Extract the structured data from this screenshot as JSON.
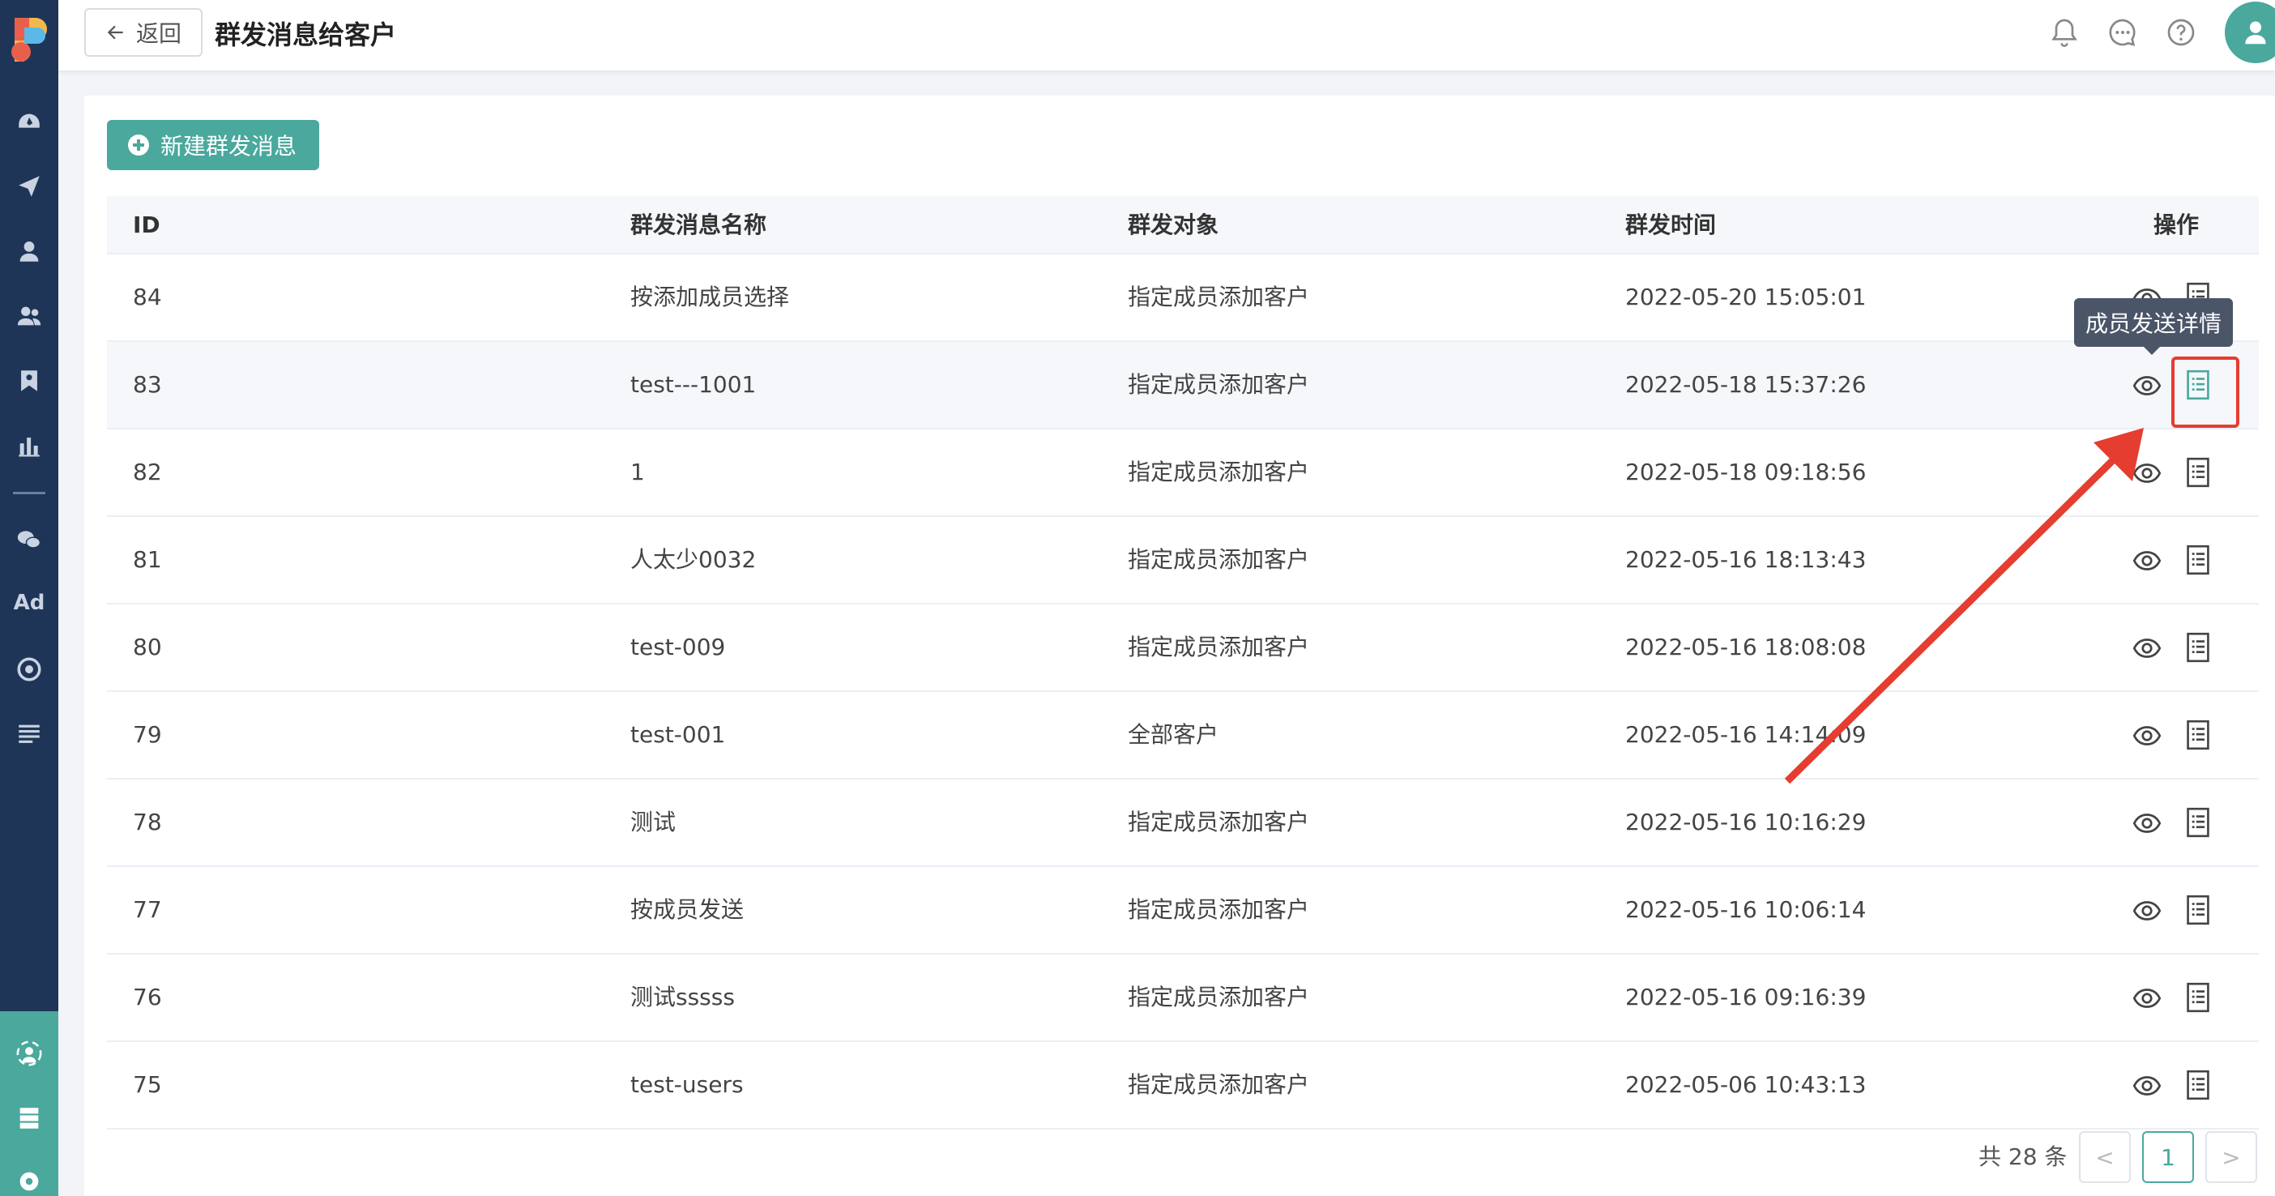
{
  "header": {
    "back_label": "返回",
    "title": "群发消息给客户"
  },
  "toolbar": {
    "new_label": "新建群发消息"
  },
  "table": {
    "headers": {
      "id": "ID",
      "name": "群发消息名称",
      "target": "群发对象",
      "time": "群发时间",
      "op": "操作"
    },
    "rows": [
      {
        "id": "84",
        "name": "按添加成员选择",
        "target": "指定成员添加客户",
        "time": "2022-05-20 15:05:01"
      },
      {
        "id": "83",
        "name": "test---1001",
        "target": "指定成员添加客户",
        "time": "2022-05-18 15:37:26"
      },
      {
        "id": "82",
        "name": "1",
        "target": "指定成员添加客户",
        "time": "2022-05-18 09:18:56"
      },
      {
        "id": "81",
        "name": "人太少0032",
        "target": "指定成员添加客户",
        "time": "2022-05-16 18:13:43"
      },
      {
        "id": "80",
        "name": "test-009",
        "target": "指定成员添加客户",
        "time": "2022-05-16 18:08:08"
      },
      {
        "id": "79",
        "name": "test-001",
        "target": "全部客户",
        "time": "2022-05-16 14:14:09"
      },
      {
        "id": "78",
        "name": "测试",
        "target": "指定成员添加客户",
        "time": "2022-05-16 10:16:29"
      },
      {
        "id": "77",
        "name": "按成员发送",
        "target": "指定成员添加客户",
        "time": "2022-05-16 10:06:14"
      },
      {
        "id": "76",
        "name": "测试sssss",
        "target": "指定成员添加客户",
        "time": "2022-05-16 09:16:39"
      },
      {
        "id": "75",
        "name": "test-users",
        "target": "指定成员添加客户",
        "time": "2022-05-06 10:43:13"
      }
    ]
  },
  "tooltip": {
    "text": "成员发送详情"
  },
  "pagination": {
    "total": "共 28 条",
    "current": "1",
    "prev": "<",
    "next": ">"
  },
  "sidebar": {
    "ad_label": "Ad"
  },
  "colors": {
    "sidebar": "#1e3558",
    "accent": "#4aa89d",
    "annotation": "#e53d2f"
  }
}
